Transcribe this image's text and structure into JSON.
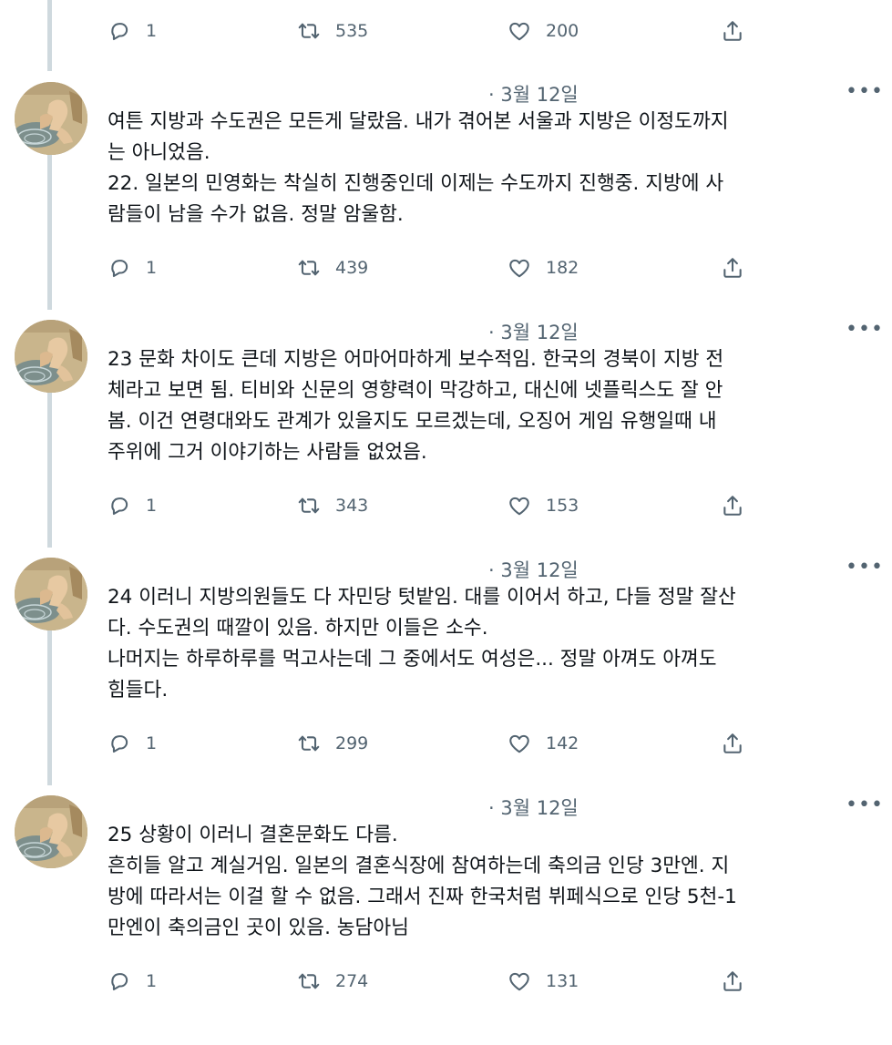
{
  "top_actions": {
    "reply": "1",
    "retweet": "535",
    "like": "200"
  },
  "tweets": [
    {
      "date": "· 3월 12일",
      "text": "여튼 지방과 수도권은 모든게 달랐음. 내가 겪어본 서울과 지방은 이정도까지\n는 아니었음.\n22. 일본의 민영화는 착실히 진행중인데 이제는 수도까지 진행중. 지방에 사\n람들이 남을 수가 없음. 정말 암울함.",
      "reply": "1",
      "retweet": "439",
      "like": "182"
    },
    {
      "date": "· 3월 12일",
      "text": "23 문화 차이도 큰데 지방은 어마어마하게 보수적임. 한국의 경북이 지방 전\n체라고 보면 됨. 티비와 신문의 영향력이 막강하고, 대신에 넷플릭스도 잘 안\n봄. 이건 연령대와도 관계가 있을지도 모르겠는데, 오징어 게임 유행일때 내\n주위에 그거 이야기하는 사람들 없었음.",
      "reply": "1",
      "retweet": "343",
      "like": "153"
    },
    {
      "date": "· 3월 12일",
      "text": "24 이러니 지방의원들도 다 자민당 텃밭임. 대를 이어서 하고, 다들 정말 잘산\n다. 수도권의 때깔이 있음. 하지만 이들은 소수.\n나머지는 하루하루를 먹고사는데 그 중에서도 여성은... 정말 아껴도 아껴도\n힘들다.",
      "reply": "1",
      "retweet": "299",
      "like": "142"
    },
    {
      "date": "· 3월 12일",
      "text": "25 상황이 이러니 결혼문화도 다름.\n흔히들 알고 계실거임. 일본의 결혼식장에 참여하는데 축의금 인당 3만엔. 지\n방에 따라서는 이걸 할 수 없음. 그래서 진짜 한국처럼 뷔페식으로 인당 5천-1\n만엔이 축의금인 곳이 있음. 농담아님",
      "reply": "1",
      "retweet": "274",
      "like": "131"
    }
  ],
  "more_label": "•••",
  "icons": {
    "reply": "reply-bubble-icon",
    "retweet": "retweet-arrows-icon",
    "like": "heart-icon",
    "share": "share-upload-icon",
    "avatar": "painting-avatar"
  },
  "colors": {
    "secondary_text": "#536471",
    "thread_line": "#cfd9de",
    "text": "#0f1419"
  }
}
